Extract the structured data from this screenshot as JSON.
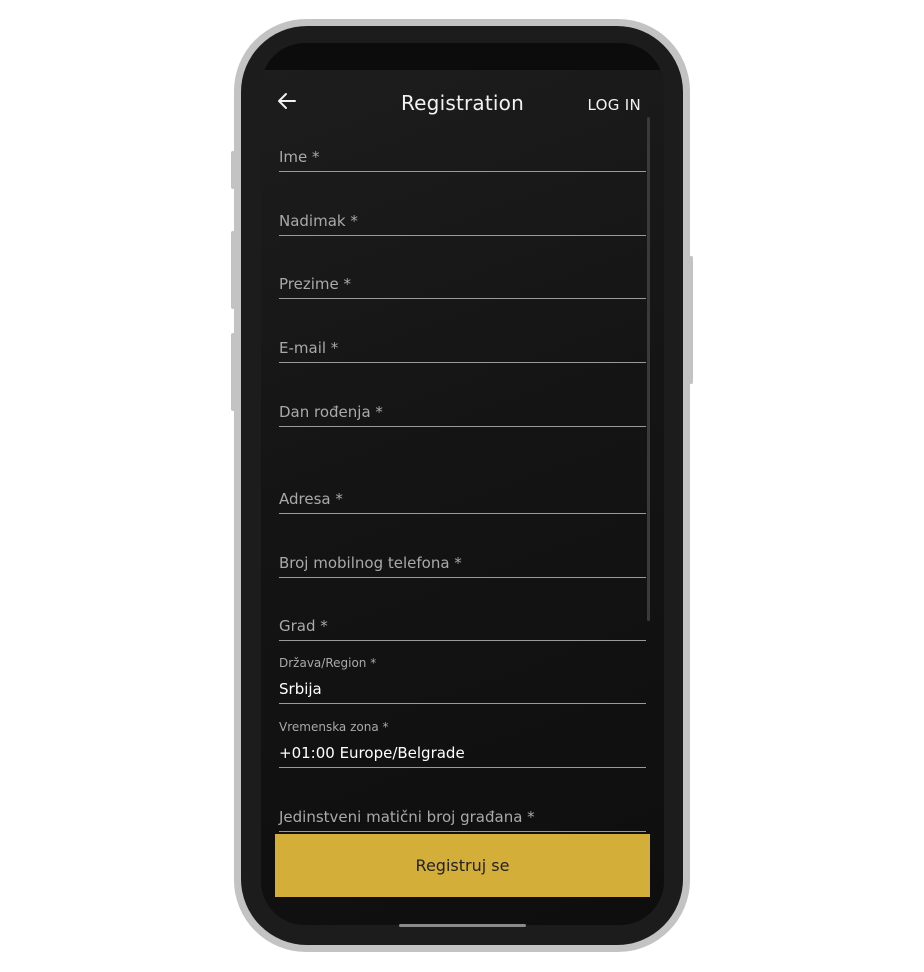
{
  "header": {
    "title": "Registration",
    "login_label": "LOG IN",
    "back_icon": "arrow-left-icon"
  },
  "form": {
    "fields": [
      {
        "placeholder": "Ime *"
      },
      {
        "placeholder": "Nadimak *"
      },
      {
        "placeholder": "Prezime *"
      },
      {
        "placeholder": "E-mail *"
      },
      {
        "placeholder": "Dan rođenja *"
      },
      {
        "placeholder": "Adresa *"
      },
      {
        "placeholder": "Broj mobilnog telefona *"
      },
      {
        "placeholder": "Grad *"
      }
    ],
    "country": {
      "label": "Država/Region *",
      "value": "Srbija"
    },
    "timezone": {
      "label": "Vremenska zona *",
      "value": "+01:00 Europe/Belgrade"
    },
    "jmbg": {
      "placeholder": "Jedinstveni matični broj građana *"
    }
  },
  "submit_label": "Registruj se",
  "colors": {
    "accent": "#d3ae38",
    "background": "#141414",
    "text": "#f2f2f2",
    "muted": "#a9a9a9"
  }
}
